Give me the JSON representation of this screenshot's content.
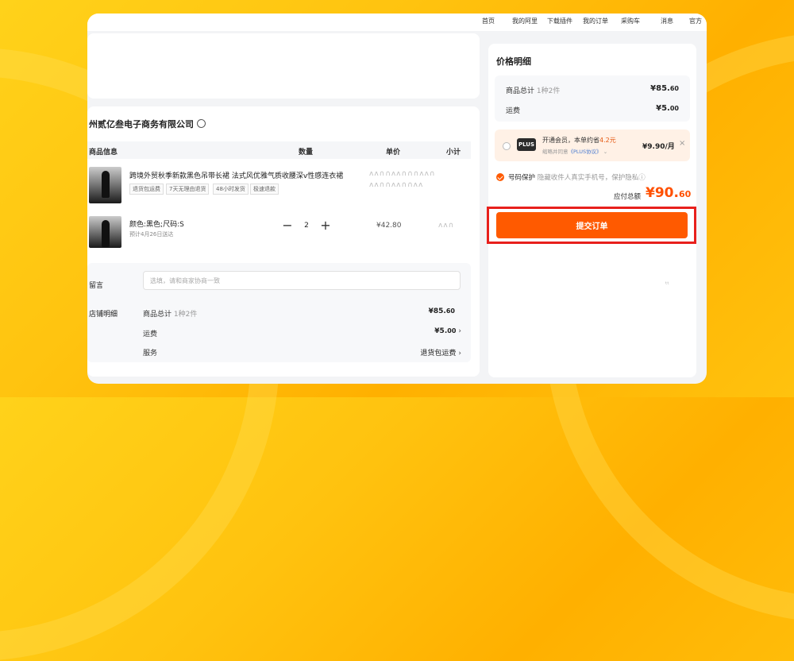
{
  "nav": [
    "首页",
    "我的阿里",
    "下载插件",
    "我的订单",
    "采购车",
    "消息",
    "官方"
  ],
  "shop": {
    "name": "州贰亿叁电子商务有限公司",
    "columns": {
      "info": "商品信息",
      "qty": "数量",
      "unit_price": "单价",
      "subtotal": "小计"
    }
  },
  "product": {
    "title": "跨境外贸秋季新款黑色吊带长裙 法式风优雅气质收腰深v性感连衣裙",
    "tags": [
      "退货包运费",
      "7天无理由退货",
      "48小时发货",
      "极速退款"
    ],
    "variant": "颜色:黑色;尺码:S",
    "ship_date": "预计4月26日送达",
    "qty": "2",
    "qty_minus": "−",
    "qty_plus": "+",
    "price": "¥42.80",
    "garbled_header_price": "ʌʌ∩∩ʌʌ∩∩∩ʌʌ∩",
    "garbled_header_sub": "ʌʌ∩∩ʌʌ∩∩ʌʌ",
    "garbled_price_right": "ʌʌ∩"
  },
  "message": {
    "label": "留言",
    "placeholder": "选填，请和商家协商一致"
  },
  "shop_detail": {
    "label": "店铺明细",
    "goods_label": "商品总计",
    "goods_sub": "1种2件",
    "goods_int": "¥85.",
    "goods_dec": "60",
    "freight_label": "运费",
    "freight_int": "¥5.",
    "freight_dec": "00",
    "service_label": "服务",
    "service_value": "退货包运费"
  },
  "price_detail": {
    "title": "价格明细",
    "goods_label": "商品总计",
    "goods_sub": "1种2件",
    "goods_int": "¥85.",
    "goods_dec": "60",
    "freight_label": "运费",
    "freight_int": "¥5.",
    "freight_dec": "00"
  },
  "plus": {
    "logo": "PLUS",
    "title_a": "开通会员，本单约省",
    "title_b": "4.2元",
    "sub_a": "缩略并同意",
    "sub_b": "《PLUS协议》",
    "price": "¥9.90/月",
    "close": "×"
  },
  "protect": {
    "label": "号码保护",
    "desc": "隐藏收件人真实手机号，保护隐私"
  },
  "total": {
    "label": "应付总额",
    "int": "¥90.",
    "dec": "60"
  },
  "submit_label": "提交订单",
  "faint_mark": "ᵗᵗ"
}
